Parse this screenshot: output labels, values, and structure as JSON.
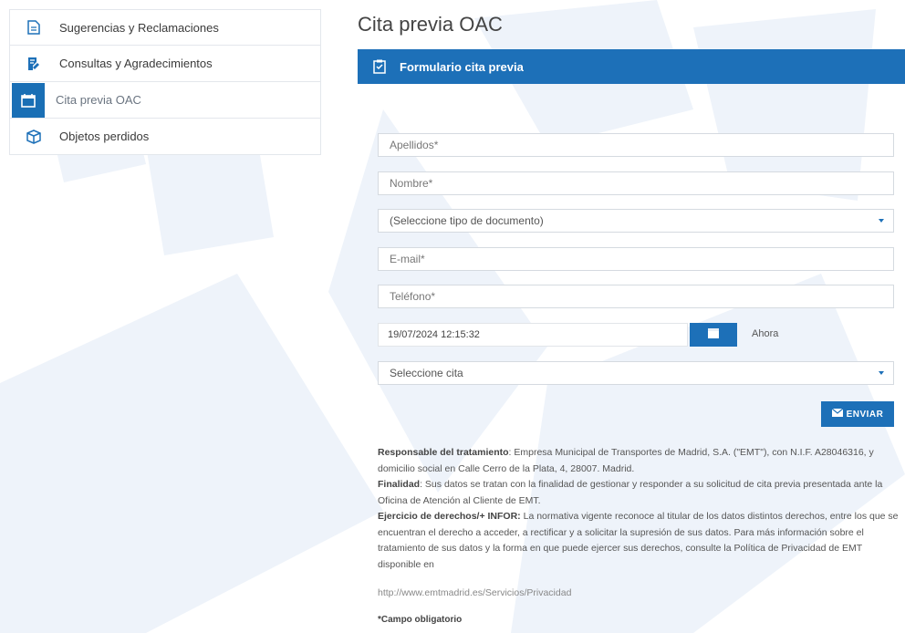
{
  "sidebar": {
    "items": [
      {
        "label": "Sugerencias y Reclamaciones",
        "icon": "document-icon",
        "active": false
      },
      {
        "label": "Consultas y Agradecimientos",
        "icon": "edit-document-icon",
        "active": false
      },
      {
        "label": "Cita previa OAC",
        "icon": "calendar-icon",
        "active": true
      },
      {
        "label": "Objetos perdidos",
        "icon": "box-icon",
        "active": false
      }
    ]
  },
  "main": {
    "title": "Cita previa OAC",
    "panel_title": "Formulario cita previa",
    "fields": {
      "apellidos_placeholder": "Apellidos*",
      "nombre_placeholder": "Nombre*",
      "documento_select": "(Seleccione tipo de documento)",
      "email_placeholder": "E-mail*",
      "telefono_placeholder": "Teléfono*",
      "fecha_value": "19/07/2024 12:15:32",
      "ahora_label": "Ahora",
      "cita_select": "Seleccione cita"
    },
    "send_label": "ENVIAR",
    "legal": {
      "responsable_label": "Responsable del tratamiento",
      "responsable_text": ": Empresa Municipal de Transportes de Madrid, S.A. (\"EMT\"), con N.I.F. A28046316, y domicilio social en Calle Cerro de la Plata, 4, 28007. Madrid.",
      "finalidad_label": "Finalidad",
      "finalidad_text": ": Sus datos se tratan con la finalidad de gestionar y responder a su solicitud de cita previa presentada ante la Oficina de Atención al Cliente de EMT.",
      "ejercicio_label": "Ejercicio de derechos/+ INFOR:",
      "ejercicio_text": " La normativa vigente reconoce al titular de los datos distintos derechos, entre los que se encuentran el derecho a acceder, a rectificar y a solicitar la supresión de sus datos. Para más información sobre el tratamiento de sus datos y la forma en que puede ejercer sus derechos, consulte la Política de Privacidad de EMT disponible en",
      "link": "http://www.emtmadrid.es/Servicios/Privacidad",
      "required_note": "*Campo obligatorio"
    }
  },
  "colors": {
    "accent": "#1d70b8",
    "sidebar_active": "#1a6fb5",
    "watermark": "#eef3fa"
  }
}
